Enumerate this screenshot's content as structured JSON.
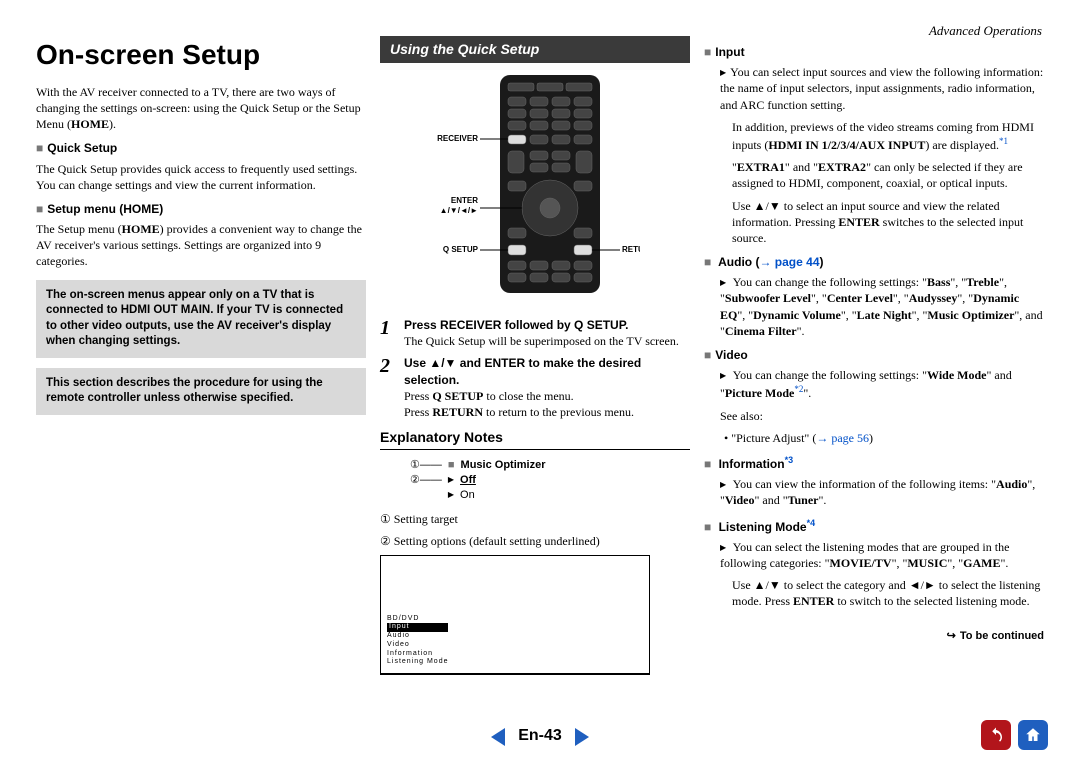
{
  "header": {
    "section": "Advanced Operations"
  },
  "col1": {
    "title": "On-screen Setup",
    "intro_a": "With the AV receiver connected to a TV, there are two ways of changing the settings on-screen: using the Quick Setup or the Setup Menu (",
    "intro_b": "HOME",
    "intro_c": ").",
    "h_quick": "Quick Setup",
    "p_quick": "The Quick Setup provides quick access to frequently used settings. You can change settings and view the current information.",
    "h_setup": "Setup menu (HOME)",
    "p_setup_a": "The Setup menu (",
    "p_setup_b": "HOME",
    "p_setup_c": ") provides a convenient way to change the AV receiver's various settings. Settings are organized into 9 categories.",
    "note1": "The on-screen menus appear only on a TV that is connected to HDMI OUT MAIN. If your TV is connected to other video outputs, use the AV receiver's display when changing settings.",
    "note2": "This section describes the procedure for using the remote controller unless otherwise specified."
  },
  "col2": {
    "bar": "Using the Quick Setup",
    "labels": {
      "receiver": "RECEIVER",
      "enter": "ENTER",
      "arrows": "▲/▼/◄/►",
      "qsetup": "Q SETUP",
      "return": "RETURN"
    },
    "step1_t": "Press RECEIVER followed by Q SETUP.",
    "step1_p": "The Quick Setup will be superimposed on the TV screen.",
    "step2_t": "Use ▲/▼ and ENTER to make the desired selection.",
    "step2_p1a": "Press ",
    "step2_p1b": "Q SETUP",
    "step2_p1c": " to close the menu.",
    "step2_p2a": "Press ",
    "step2_p2b": "RETURN",
    "step2_p2c": " to return to the previous menu.",
    "expl_head": "Explanatory Notes",
    "expl_music": "Music Optimizer",
    "expl_off": "Off",
    "expl_on": "On",
    "expl_1": "① Setting target",
    "expl_2": "② Setting options (default setting underlined)",
    "tv": {
      "l1": "BD/DVD",
      "l2": "Input",
      "l3": "Audio",
      "l4": "Video",
      "l5": "Information",
      "l6": "Listening Mode"
    }
  },
  "col3": {
    "input_h": "Input",
    "input_p1": "You can select input sources and view the following information: the name of input selectors, input assignments, radio information, and ARC function setting.",
    "input_p2a": "In addition, previews of the video streams coming from HDMI inputs (",
    "input_p2b": "HDMI IN 1/2/3/4/AUX INPUT",
    "input_p2c": ") are displayed.",
    "input_ref1": "*1",
    "input_extra_a": "\"",
    "input_extra_b": "EXTRA1",
    "input_extra_c": "\" and \"",
    "input_extra_d": "EXTRA2",
    "input_extra_e": "\" can only be selected if they are assigned to HDMI, component, coaxial, or optical inputs.",
    "input_use_a": "Use ▲/▼ to select an input source and view the related information. Pressing ",
    "input_use_b": "ENTER",
    "input_use_c": " switches to the selected input source.",
    "audio_h": "Audio (",
    "audio_link": "→ page 44",
    "audio_h2": ")",
    "audio_p": "You can change the following settings: \"Bass\", \"Treble\", \"Subwoofer Level\", \"Center Level\", \"Audyssey\", \"Dynamic EQ\", \"Dynamic Volume\", \"Late Night\", \"Music Optimizer\", and \"Cinema Filter\".",
    "video_h": "Video",
    "video_p": "You can change the following settings: \"Wide Mode\" and \"Picture Mode",
    "video_ref": "*2",
    "video_p2": "\".",
    "video_see": "See also:",
    "video_adj_a": "\"Picture Adjust\" (",
    "video_adj_link": "→ page 56",
    "video_adj_b": ")",
    "info_h": "Information",
    "info_ref": "*3",
    "info_p": "You can view the information of the following items: \"Audio\", \"Video\" and \"Tuner\".",
    "lm_h": "Listening Mode",
    "lm_ref": "*4",
    "lm_p1": "You can select the listening modes that are grouped in the following categories: \"MOVIE/TV\", \"MUSIC\", \"GAME\".",
    "lm_use_a": "Use ▲/▼ to select the category and ◄/► to select the listening mode. Press ",
    "lm_use_b": "ENTER",
    "lm_use_c": " to switch to the selected listening mode.",
    "tbc": "To be continued"
  },
  "footer": {
    "page": "En-43"
  }
}
